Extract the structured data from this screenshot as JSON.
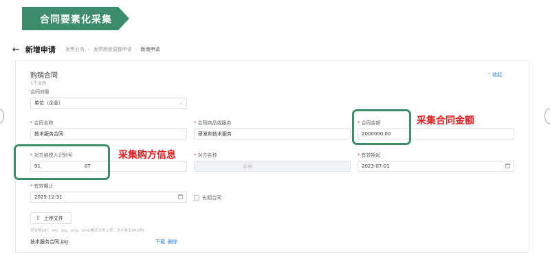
{
  "banner": {
    "title": "合同要素化采集",
    "color": "#3d8d6c"
  },
  "header": {
    "back_icon": "arrow-left-icon",
    "title": "新增申请",
    "breadcrumb": [
      "发票业务",
      "发票额度调整申请",
      "新增申请"
    ]
  },
  "section": {
    "title": "购销合同",
    "subtitle": "1个文件",
    "collapse_label": "收起",
    "collapse_icon": "chevron-up-icon"
  },
  "fields": {
    "contract_party": {
      "label": "合同对象",
      "value": "单位（企业）"
    },
    "contract_name": {
      "label": "合同名称",
      "value": "技术服务合同"
    },
    "goods_service": {
      "label": "合同商品或服务",
      "value": "研发和技术服务"
    },
    "contract_amount": {
      "label": "合同金额",
      "value": "2000000.00"
    },
    "counterparty_tax_id": {
      "label": "对方纳税人识别号",
      "value_prefix": "91",
      "value_suffix": "0T"
    },
    "counterparty_name": {
      "label": "对方名称",
      "value": "公司"
    },
    "valid_start": {
      "label": "有效期起",
      "value": "2023-07-01"
    },
    "valid_end": {
      "label": "有效期止",
      "value": "2025-12-31"
    },
    "long_term": {
      "label": "长期合同",
      "checked": false
    }
  },
  "upload": {
    "button_label": "上传文件",
    "hint": "仅支持pdf、ofd、jpg、png、bmp格式文件上传，大小在10M以内",
    "file_name": "技术服务合同.jpg",
    "download_label": "下载",
    "delete_label": "删除"
  },
  "annotations": {
    "amount_note": "采集合同金额",
    "buyer_note": "采集购方信息",
    "text_color": "#e02020",
    "box_color": "#3d8d6c"
  }
}
